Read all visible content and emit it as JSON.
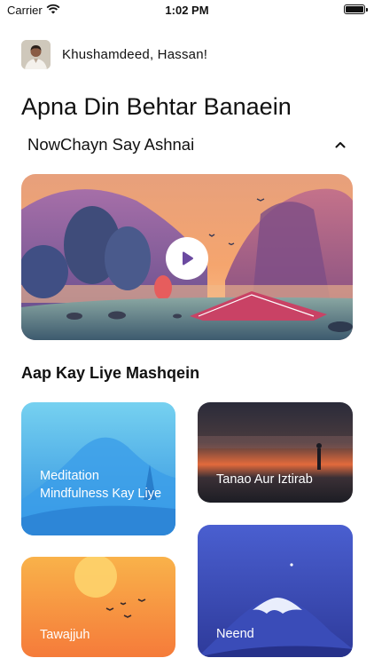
{
  "status": {
    "carrier": "Carrier",
    "time": "1:02 PM"
  },
  "greeting": "Khushamdeed, Hassan!",
  "title": "Apna Din Behtar Banaein",
  "subheading": "NowChayn Say Ashnai",
  "section_title": "Aap Kay Liye Mashqein",
  "cards": {
    "meditation": "Meditation Mindfulness Kay Liye",
    "stress": "Tanao Aur Iztirab",
    "focus": "Tawajjuh",
    "sleep": "Neend"
  }
}
